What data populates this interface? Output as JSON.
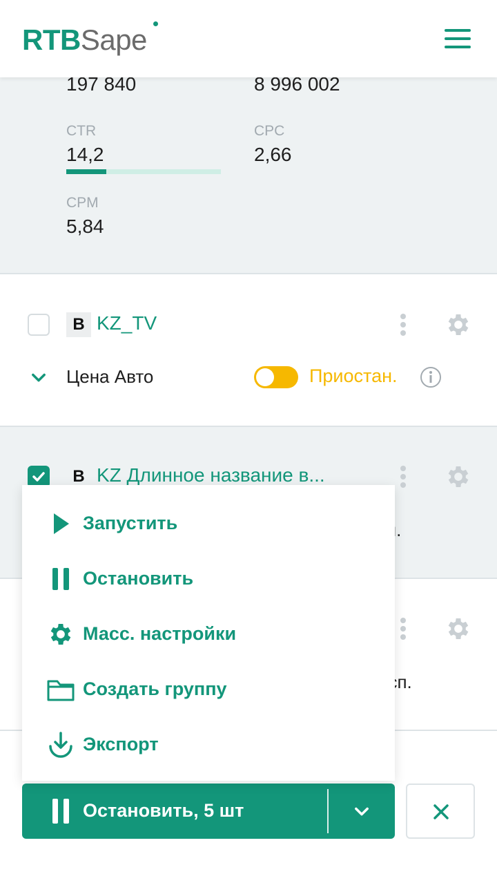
{
  "header": {
    "logo_rtb": "RTB",
    "logo_sape": "Sape",
    "menu_icon": "hamburger-icon"
  },
  "stats": {
    "impressions_value": "197 840",
    "spend_value": "8 996 002",
    "ctr_label": "CTR",
    "ctr_value": "14,2",
    "ctr_progress": 0.26,
    "cpc_label": "CPC",
    "cpc_value": "2,66",
    "cpm_label": "CPM",
    "cpm_value": "5,84"
  },
  "campaigns": [
    {
      "badge": "B",
      "name": "KZ_TV",
      "strategy": "Цена Авто",
      "status": "Приостан.",
      "checked": false
    },
    {
      "badge": "B",
      "name": "KZ  Длинное название в...",
      "status_peek": "п.",
      "checked": true
    },
    {
      "status_peek": "асп."
    }
  ],
  "menu": {
    "items": [
      {
        "label": "Запустить",
        "icon": "play-icon"
      },
      {
        "label": "Остановить",
        "icon": "pause-icon"
      },
      {
        "label": "Масс. настройки",
        "icon": "gear-icon"
      },
      {
        "label": "Создать группу",
        "icon": "folder-icon"
      },
      {
        "label": "Экспорт",
        "icon": "download-icon"
      }
    ]
  },
  "action_bar": {
    "main_label": "Остановить, 5 шт",
    "main_icon": "pause-icon",
    "dropdown_icon": "chevron-down-icon",
    "close_icon": "close-icon"
  },
  "colors": {
    "brand": "#13967a",
    "paused": "#f6b800",
    "muted": "#a2aab0"
  }
}
